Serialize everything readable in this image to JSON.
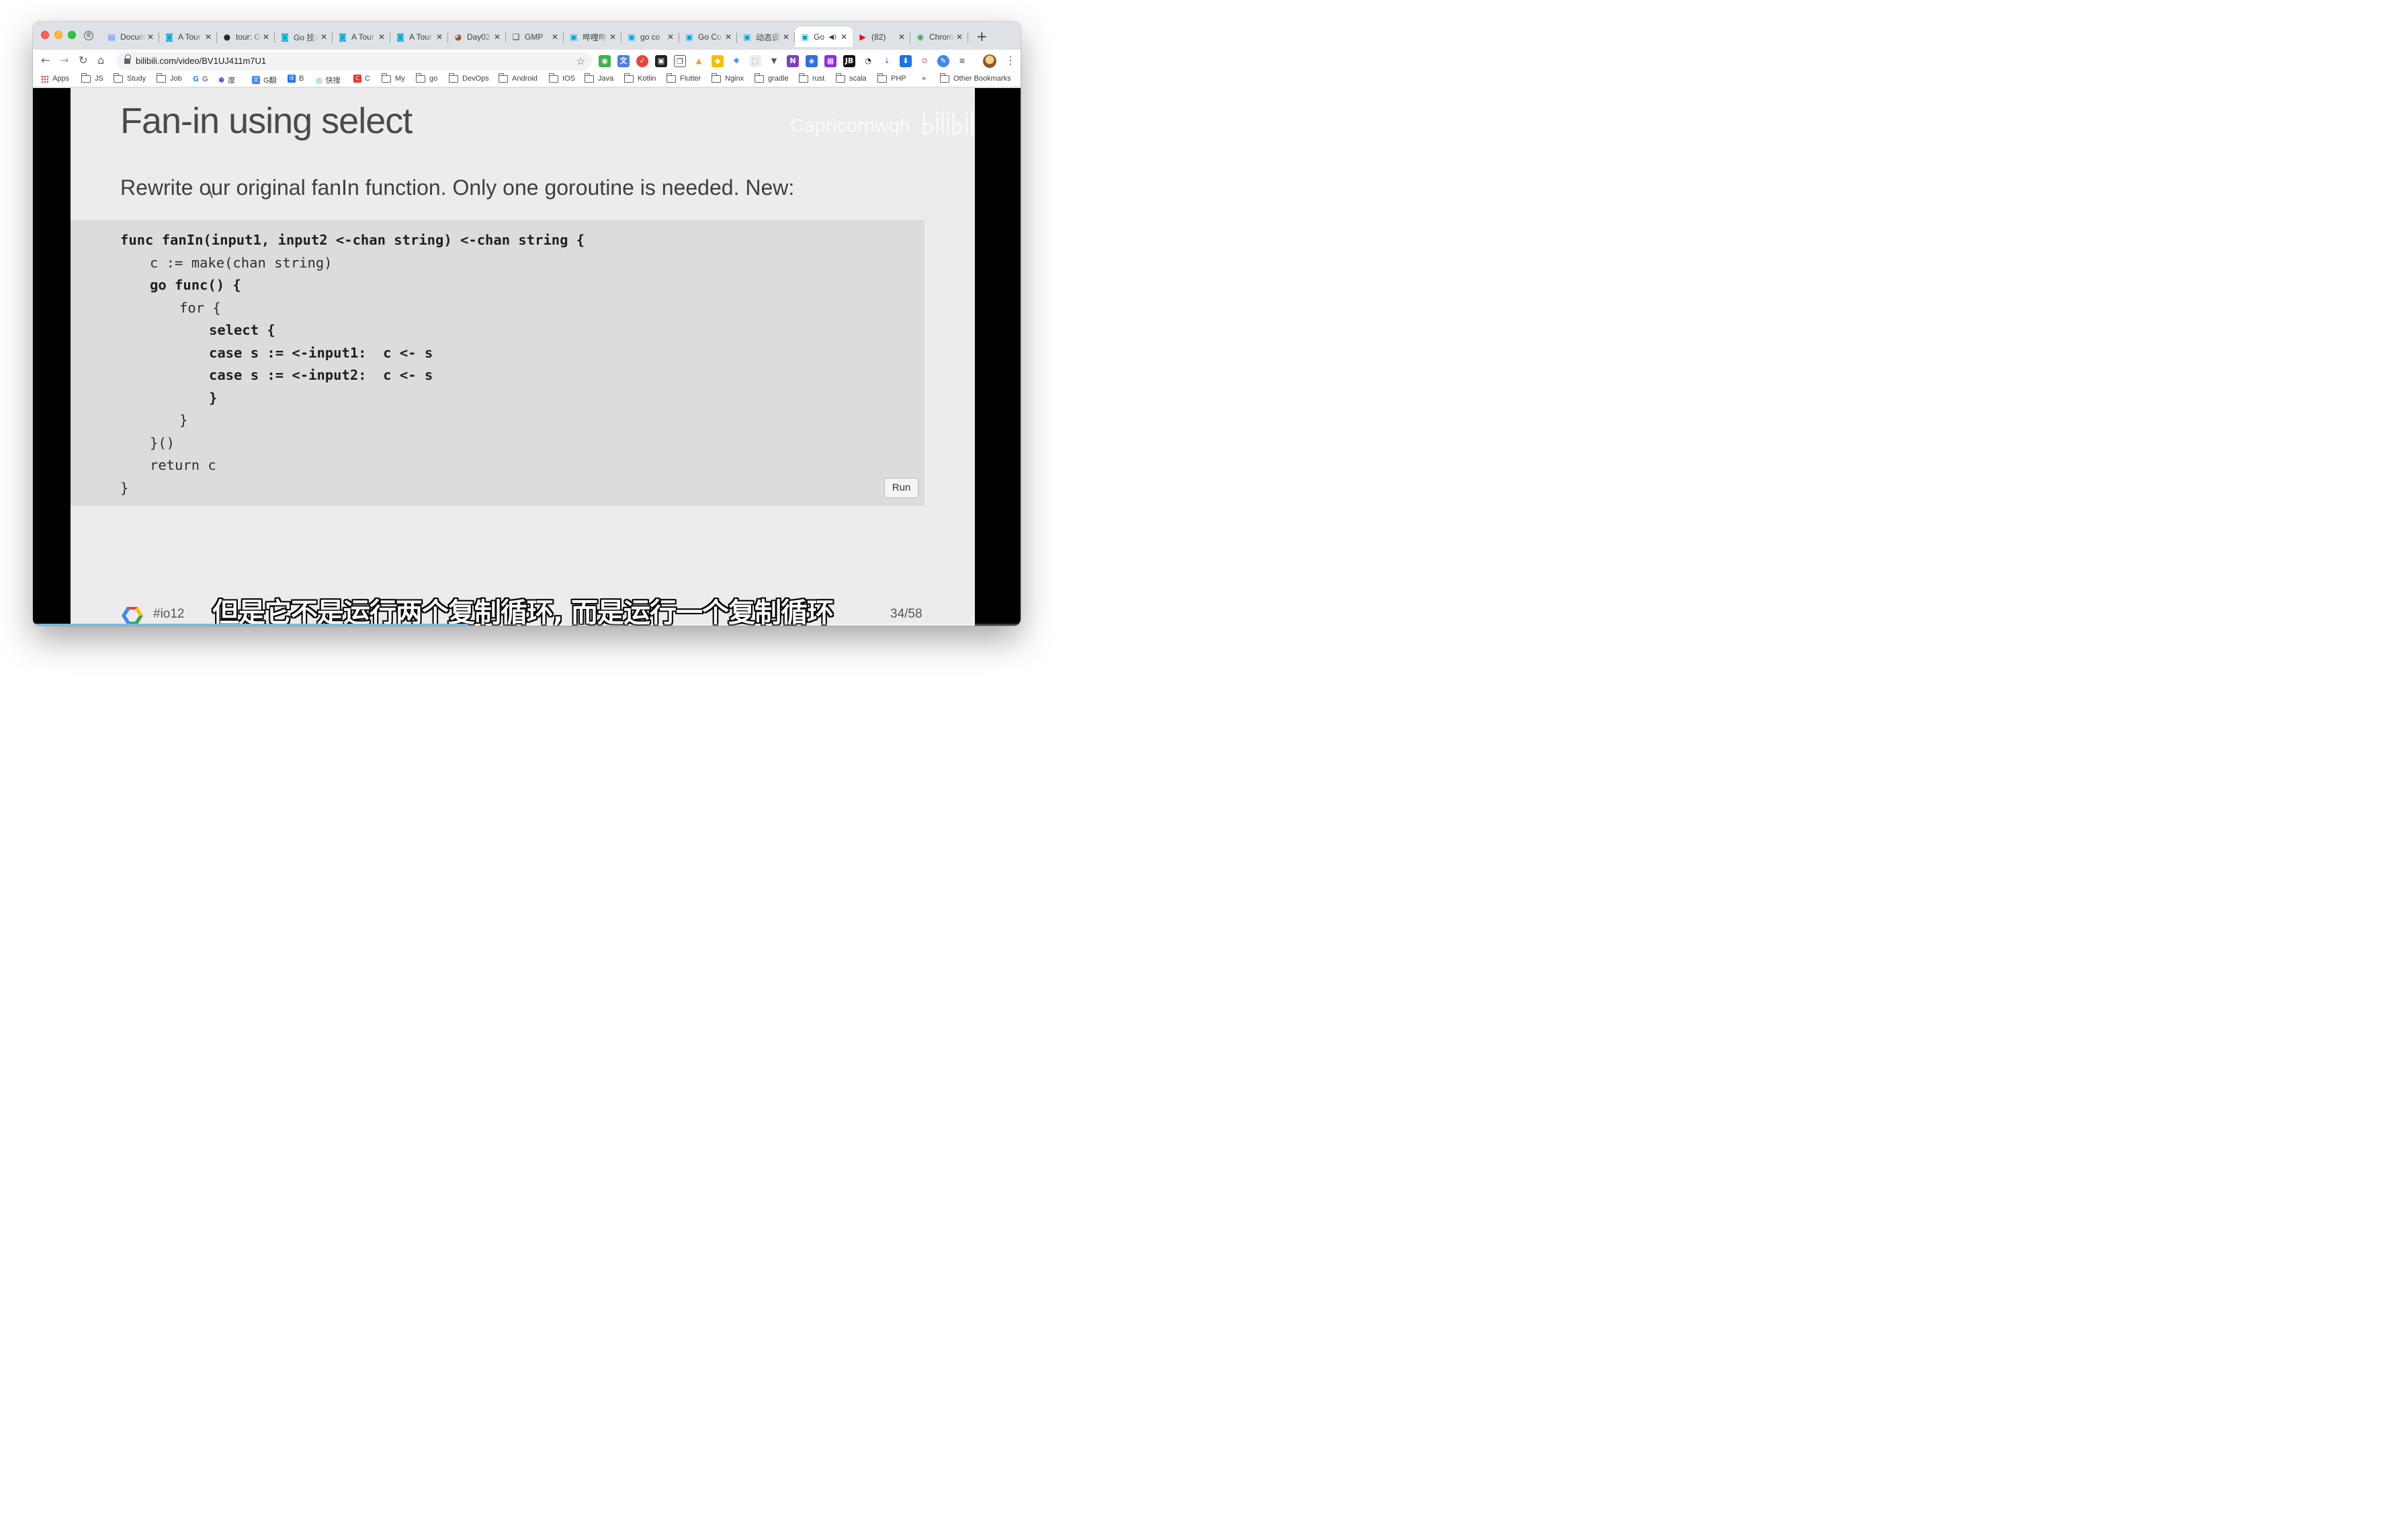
{
  "browser": {
    "tabs": [
      {
        "title": "Docum",
        "favicon": "document-icon",
        "color": "#4285f4"
      },
      {
        "title": "A Tour",
        "favicon": "gopher-icon",
        "color": "#00add8"
      },
      {
        "title": "tour: G",
        "favicon": "github-icon",
        "color": "#24292e"
      },
      {
        "title": "Go 技术",
        "favicon": "gopher-icon",
        "color": "#00add8"
      },
      {
        "title": "A Tour",
        "favicon": "gopher-icon",
        "color": "#00add8"
      },
      {
        "title": "A Tour",
        "favicon": "gopher-icon",
        "color": "#00add8"
      },
      {
        "title": "Day02",
        "favicon": "avatar-icon",
        "color": "#a0522d"
      },
      {
        "title": "GMP",
        "favicon": "book-icon",
        "color": "#3c4043"
      },
      {
        "title": "哔哩哔",
        "favicon": "bilibili-icon",
        "color": "#00a1d6"
      },
      {
        "title": "go co",
        "favicon": "bilibili-icon",
        "color": "#00a1d6"
      },
      {
        "title": "Go Co",
        "favicon": "bilibili-icon",
        "color": "#00a1d6"
      },
      {
        "title": "动态调",
        "favicon": "bilibili-icon",
        "color": "#00a1d6"
      },
      {
        "title": "Go",
        "favicon": "bilibili-icon",
        "color": "#00a1d6",
        "active": true,
        "audio": true
      },
      {
        "title": "(82)",
        "favicon": "youtube-icon",
        "color": "#ff0000"
      },
      {
        "title": "Chrom",
        "favicon": "chrome-icon",
        "color": "#34a853"
      }
    ],
    "close_glyph": "✕",
    "new_tab_glyph": "+",
    "url": "bilibili.com/video/BV1UJ411m7U1",
    "bookmarks": [
      {
        "label": "Apps",
        "type": "apps"
      },
      {
        "label": "JS",
        "type": "folder"
      },
      {
        "label": "Study",
        "type": "folder"
      },
      {
        "label": "Job",
        "type": "folder"
      },
      {
        "label": "G",
        "type": "google"
      },
      {
        "label": "度",
        "type": "baidu"
      },
      {
        "label": "G翻",
        "type": "translate"
      },
      {
        "label": "B",
        "type": "bing"
      },
      {
        "label": "快搜",
        "type": "quick"
      },
      {
        "label": "C",
        "type": "c"
      },
      {
        "label": "My",
        "type": "folder"
      },
      {
        "label": "go",
        "type": "folder"
      },
      {
        "label": "DevOps",
        "type": "folder"
      },
      {
        "label": "Android",
        "type": "folder"
      },
      {
        "label": "IOS",
        "type": "folder"
      },
      {
        "label": "Java",
        "type": "folder"
      },
      {
        "label": "Kotlin",
        "type": "folder"
      },
      {
        "label": "Flutter",
        "type": "folder"
      },
      {
        "label": "Nginx",
        "type": "folder"
      },
      {
        "label": "gradle",
        "type": "folder"
      },
      {
        "label": "rust",
        "type": "folder"
      },
      {
        "label": "scala",
        "type": "folder"
      },
      {
        "label": "PHP",
        "type": "folder"
      }
    ],
    "more_bookmarks": "»",
    "other_bookmarks": "Other Bookmarks"
  },
  "slide": {
    "title": "Fan-in using select",
    "subtitle": "Rewrite our original fanIn function. Only one goroutine is needed. New:",
    "code_lines": [
      {
        "indent": 0,
        "text": "func fanIn(input1, input2 <-chan string) <-chan string {",
        "bold": true
      },
      {
        "indent": 1,
        "text": "c := make(chan string)",
        "bold": false
      },
      {
        "indent": 1,
        "text": "go func() {",
        "bold": true
      },
      {
        "indent": 2,
        "text": "for {",
        "bold": false
      },
      {
        "indent": 3,
        "text": "select {",
        "bold": true
      },
      {
        "indent": 3,
        "text": "case s := <-input1:  c <- s",
        "bold": true
      },
      {
        "indent": 3,
        "text": "case s := <-input2:  c <- s",
        "bold": true
      },
      {
        "indent": 3,
        "text": "}",
        "bold": true
      },
      {
        "indent": 2,
        "text": "}",
        "bold": false
      },
      {
        "indent": 1,
        "text": "}()",
        "bold": false
      },
      {
        "indent": 1,
        "text": "return c",
        "bold": false
      },
      {
        "indent": 0,
        "text": "}",
        "bold": false
      }
    ],
    "run_label": "Run",
    "hashtag": "#io12",
    "page_number": "34/58"
  },
  "video": {
    "watermark": "Capricornwqh",
    "subtitle_text": "但是它不是运行两个复制循环, 而是运行一个复制循环",
    "progress_fraction": 0.44
  }
}
